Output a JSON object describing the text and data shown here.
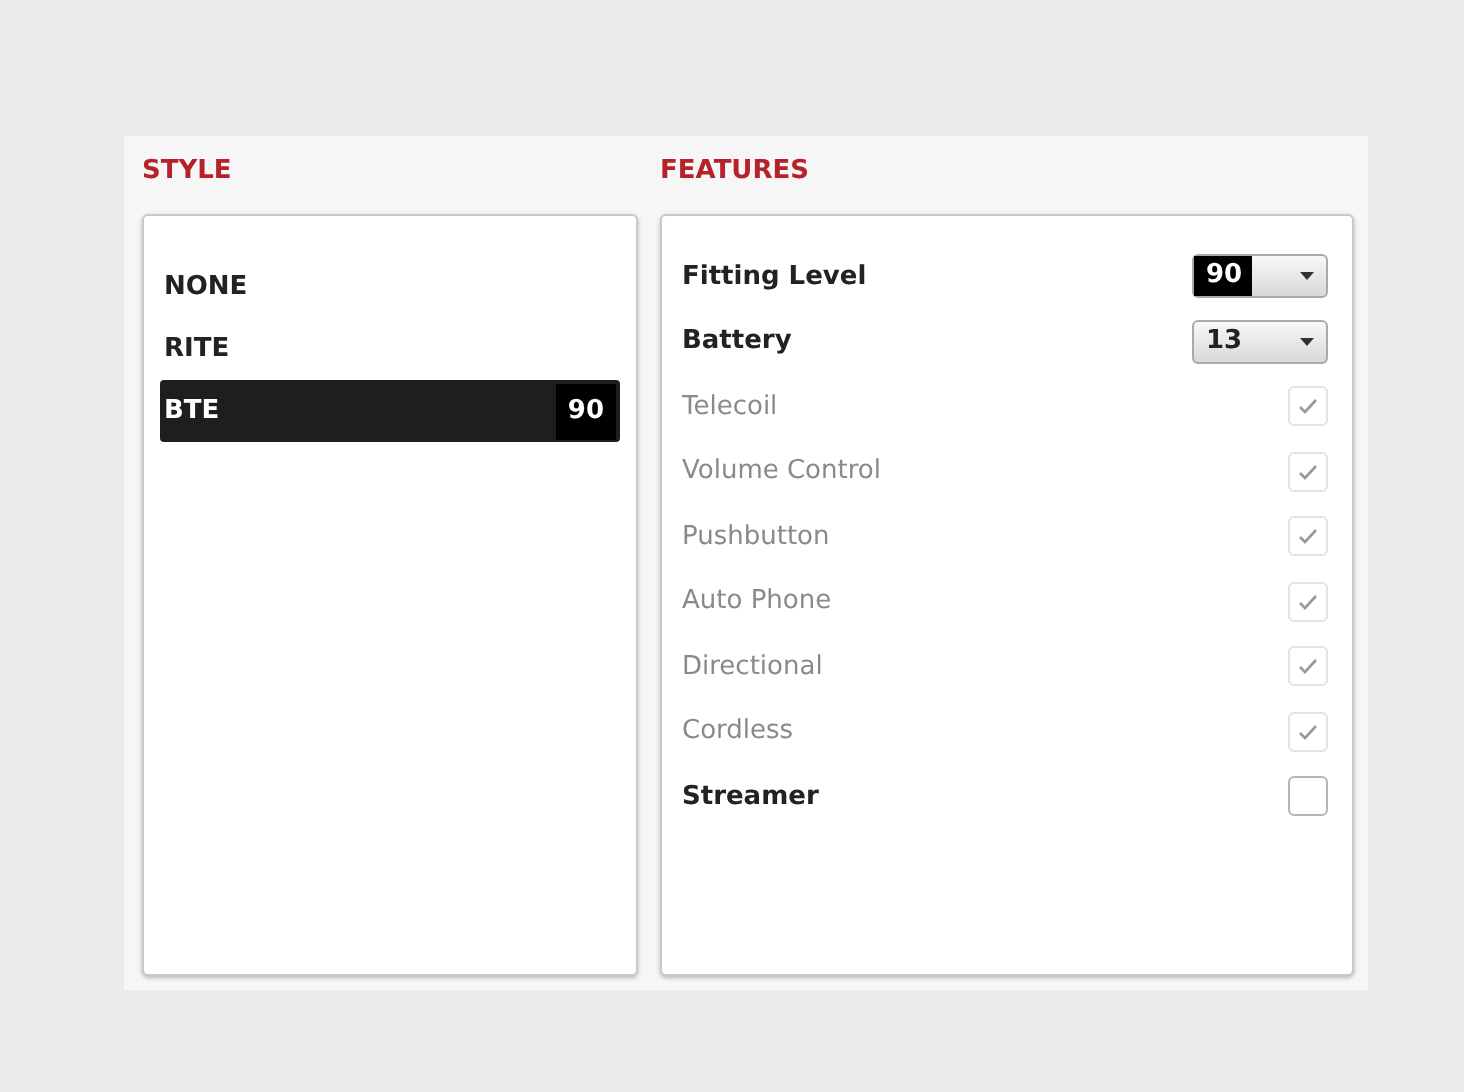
{
  "style": {
    "heading": "STYLE",
    "items": [
      {
        "label": "NONE",
        "selected": false
      },
      {
        "label": "RITE",
        "selected": false
      },
      {
        "label": "BTE",
        "selected": true,
        "badge": "90"
      }
    ]
  },
  "features": {
    "heading": "FEATURES",
    "rows": [
      {
        "kind": "dropdown",
        "label": "Fitting Level",
        "value": "90",
        "highlighted": true,
        "disabled": false
      },
      {
        "kind": "dropdown",
        "label": "Battery",
        "value": "13",
        "highlighted": false,
        "disabled": false
      },
      {
        "kind": "checkbox",
        "label": "Telecoil",
        "checked": true,
        "disabled": true
      },
      {
        "kind": "checkbox",
        "label": "Volume Control",
        "checked": true,
        "disabled": true
      },
      {
        "kind": "checkbox",
        "label": "Pushbutton",
        "checked": true,
        "disabled": true
      },
      {
        "kind": "checkbox",
        "label": "Auto Phone",
        "checked": true,
        "disabled": true
      },
      {
        "kind": "checkbox",
        "label": "Directional",
        "checked": true,
        "disabled": true
      },
      {
        "kind": "checkbox",
        "label": "Cordless",
        "checked": true,
        "disabled": true
      },
      {
        "kind": "checkbox",
        "label": "Streamer",
        "checked": false,
        "disabled": false
      }
    ]
  }
}
